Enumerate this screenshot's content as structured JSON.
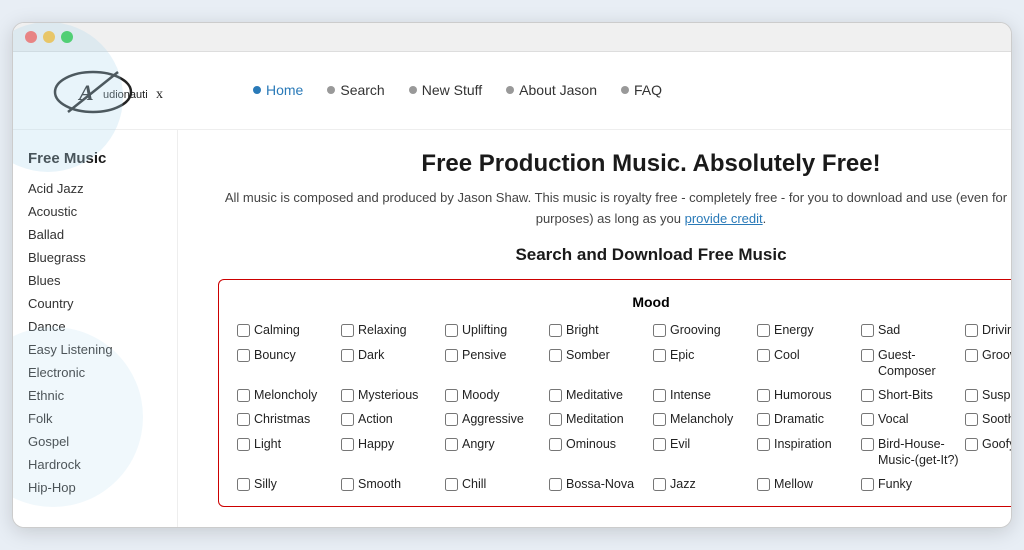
{
  "browser": {
    "dots": [
      "red",
      "yellow",
      "green"
    ]
  },
  "nav": {
    "items": [
      {
        "label": "Home",
        "active": true
      },
      {
        "label": "Search",
        "active": false
      },
      {
        "label": "New Stuff",
        "active": false
      },
      {
        "label": "About Jason",
        "active": false
      },
      {
        "label": "FAQ",
        "active": false
      }
    ]
  },
  "logo": {
    "text": "Audionautix"
  },
  "sidebar": {
    "title": "Free Music",
    "items": [
      "Acid Jazz",
      "Acoustic",
      "Ballad",
      "Bluegrass",
      "Blues",
      "Country",
      "Dance",
      "Easy Listening",
      "Electronic",
      "Ethnic",
      "Folk",
      "Gospel",
      "Hardrock",
      "Hip-Hop"
    ]
  },
  "main": {
    "heading": "Free Production Music. Absolutely Free!",
    "description_part1": "All music is composed and produced by Jason Shaw. This music is royalty free - completely free - for you to download and use (even for commercial purposes) as long as you ",
    "description_link": "provide credit",
    "description_part2": ".",
    "search_heading": "Search and Download Free Music",
    "mood_title": "Mood",
    "mood_rows": [
      [
        "Calming",
        "Relaxing",
        "Uplifting",
        "Bright",
        "Grooving",
        "Energy",
        "Sad",
        "Driving"
      ],
      [
        "Bouncy",
        "Dark",
        "Pensive",
        "Somber",
        "Epic",
        "Cool",
        "Guest-Composer",
        "Groove"
      ],
      [
        "Meloncholy",
        "Mysterious",
        "Moody",
        "Meditative",
        "Intense",
        "Humorous",
        "Short-Bits",
        "Suspenseful"
      ],
      [
        "Christmas",
        "Action",
        "Aggressive",
        "Meditation",
        "Melancholy",
        "Dramatic",
        "Vocal",
        "Soothing"
      ],
      [
        "Light",
        "Happy",
        "Angry",
        "Ominous",
        "Evil",
        "Inspiration",
        "Bird-House-Music-(get-It?)",
        "Goofy"
      ],
      [
        "Silly",
        "Smooth",
        "Chill",
        "Bossa-Nova",
        "Jazz",
        "Mellow",
        "Funky"
      ]
    ]
  }
}
